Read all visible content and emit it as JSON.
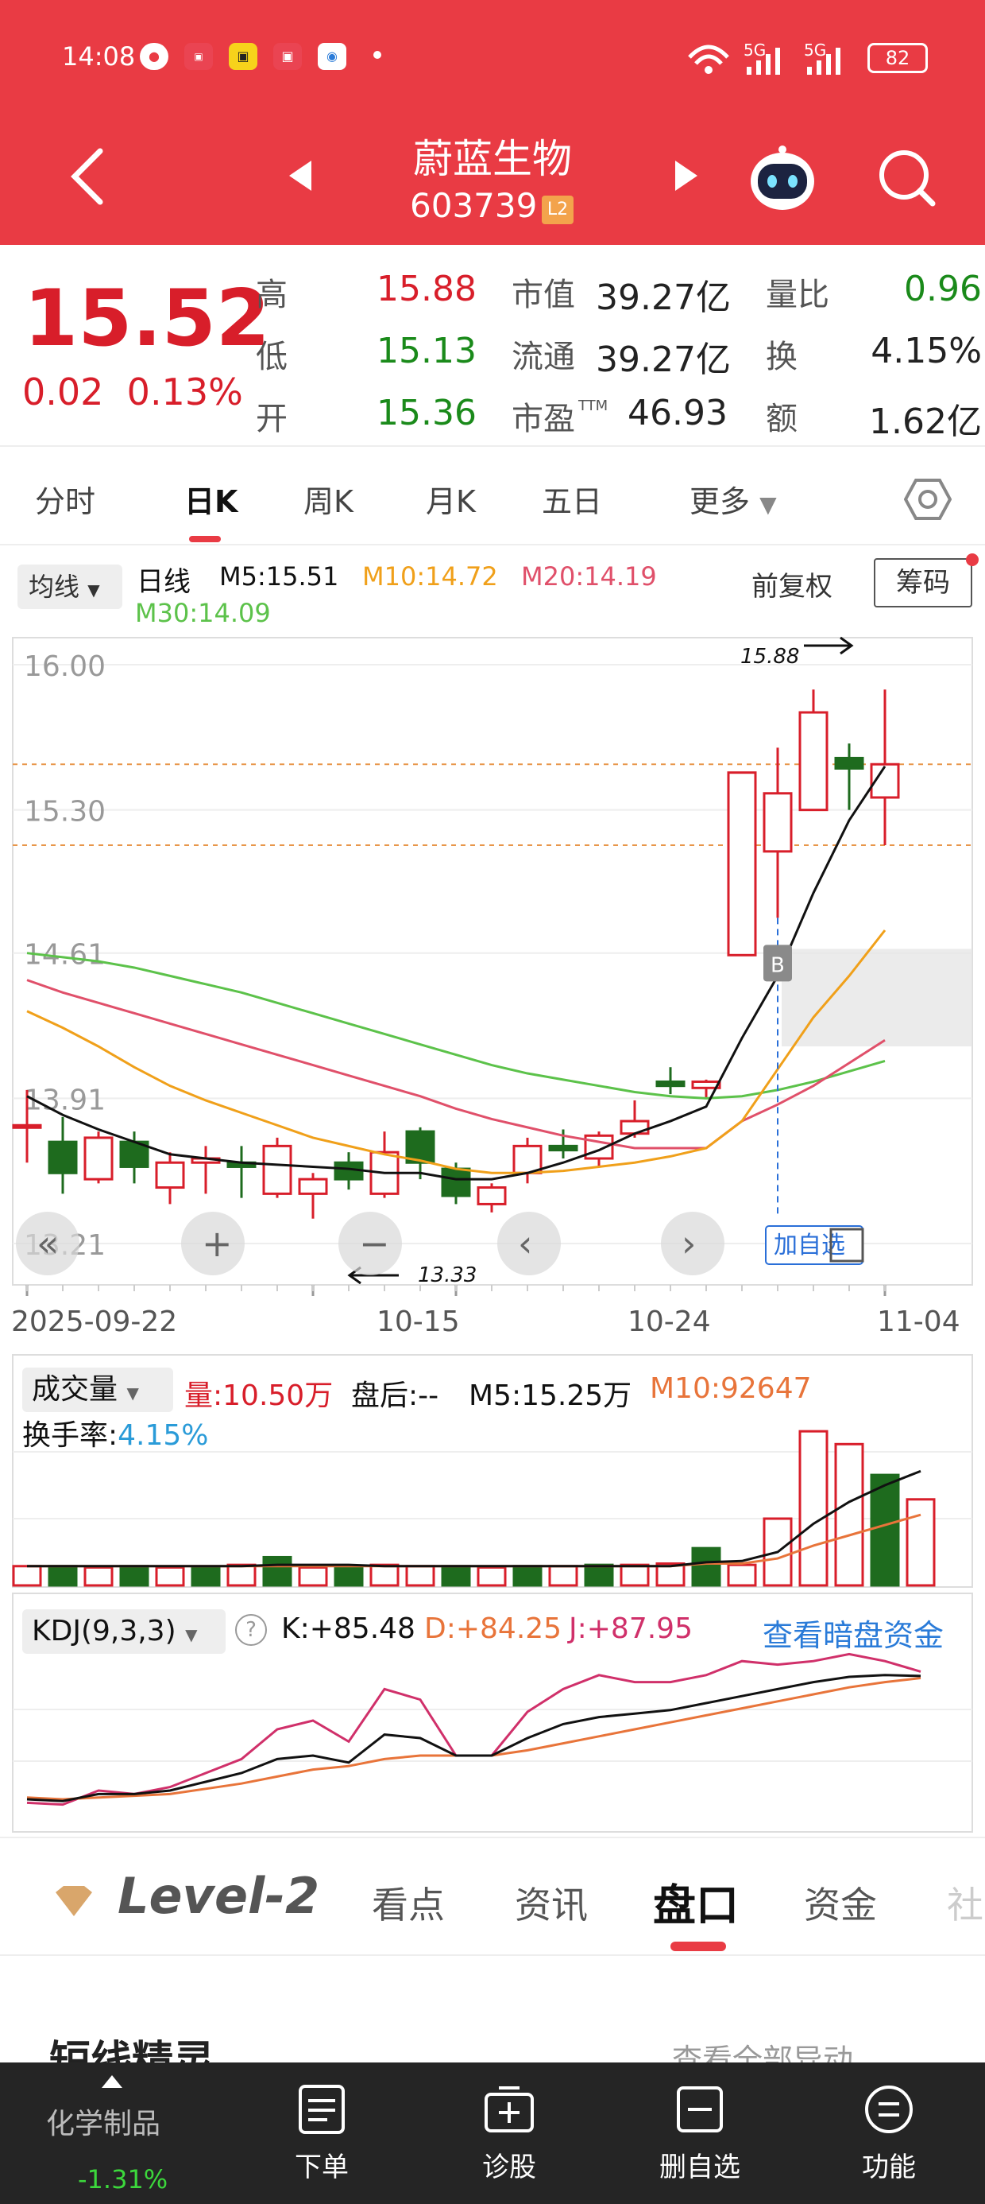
{
  "status": {
    "time": "14:08",
    "battery": "82",
    "signal1": "5G",
    "signal2": "5G"
  },
  "header": {
    "title": "蔚蓝生物",
    "code": "603739",
    "badge": "L2"
  },
  "quote": {
    "price": "15.52",
    "change": "0.02",
    "change_pct": "0.13%",
    "high_label": "高",
    "high": "15.88",
    "low_label": "低",
    "low": "15.13",
    "open_label": "开",
    "open": "15.36",
    "mktcap_label": "市值",
    "mktcap": "39.27亿",
    "float_label": "流通",
    "float": "39.27亿",
    "pe_label": "市盈",
    "pe_sup": "TTM",
    "pe": "46.93",
    "vr_label": "量比",
    "vr": "0.96",
    "turn_label": "换",
    "turn": "4.15%",
    "amt_label": "额",
    "amt": "1.62亿"
  },
  "tabs": [
    "分时",
    "日K",
    "周K",
    "月K",
    "五日",
    "更多"
  ],
  "active_tab": "日K",
  "kline": {
    "ma_selector": "均线",
    "period": "日线",
    "m5": "M5:15.51",
    "m10": "M10:14.72",
    "m20": "M20:14.19",
    "m30": "M30:14.09",
    "adjust": "前复权",
    "chip": "筹码",
    "y_labels": [
      "16.00",
      "15.30",
      "14.61",
      "13.91",
      "13.21"
    ],
    "x_labels": [
      "2025-09-22",
      "10-15",
      "10-24",
      "11-04"
    ],
    "high_annotation": "15.88",
    "low_annotation": "13.33",
    "add_watch": "加自选",
    "marker": "B",
    "colors": {
      "up": "#d81e2a",
      "down": "#1e6b1e",
      "m5": "#111111",
      "m10": "#f0a01a",
      "m20": "#e0506a",
      "m30": "#5cc24a"
    }
  },
  "chart_data": {
    "type": "candlestick",
    "ylim": [
      13.21,
      16.0
    ],
    "candles": [
      {
        "o": 13.78,
        "c": 13.78,
        "h": 13.95,
        "l": 13.6
      },
      {
        "o": 13.7,
        "c": 13.55,
        "h": 13.82,
        "l": 13.45
      },
      {
        "o": 13.52,
        "c": 13.72,
        "h": 13.75,
        "l": 13.5
      },
      {
        "o": 13.7,
        "c": 13.58,
        "h": 13.75,
        "l": 13.5
      },
      {
        "o": 13.48,
        "c": 13.6,
        "h": 13.65,
        "l": 13.4
      },
      {
        "o": 13.6,
        "c": 13.62,
        "h": 13.68,
        "l": 13.45
      },
      {
        "o": 13.6,
        "c": 13.58,
        "h": 13.68,
        "l": 13.43
      },
      {
        "o": 13.45,
        "c": 13.68,
        "h": 13.72,
        "l": 13.43
      },
      {
        "o": 13.45,
        "c": 13.52,
        "h": 13.55,
        "l": 13.33
      },
      {
        "o": 13.6,
        "c": 13.52,
        "h": 13.65,
        "l": 13.47
      },
      {
        "o": 13.45,
        "c": 13.65,
        "h": 13.75,
        "l": 13.43
      },
      {
        "o": 13.75,
        "c": 13.6,
        "h": 13.77,
        "l": 13.52
      },
      {
        "o": 13.57,
        "c": 13.44,
        "h": 13.6,
        "l": 13.4
      },
      {
        "o": 13.4,
        "c": 13.48,
        "h": 13.5,
        "l": 13.36
      },
      {
        "o": 13.55,
        "c": 13.68,
        "h": 13.72,
        "l": 13.5
      },
      {
        "o": 13.68,
        "c": 13.66,
        "h": 13.76,
        "l": 13.62
      },
      {
        "o": 13.62,
        "c": 13.73,
        "h": 13.75,
        "l": 13.58
      },
      {
        "o": 13.74,
        "c": 13.8,
        "h": 13.9,
        "l": 13.72
      },
      {
        "o": 13.99,
        "c": 13.97,
        "h": 14.06,
        "l": 13.93
      },
      {
        "o": 13.96,
        "c": 13.99,
        "h": 14.0,
        "l": 13.91
      },
      {
        "o": 14.6,
        "c": 15.48,
        "h": 15.48,
        "l": 14.6
      },
      {
        "o": 15.1,
        "c": 15.38,
        "h": 15.6,
        "l": 14.78
      },
      {
        "o": 15.3,
        "c": 15.77,
        "h": 15.88,
        "l": 15.3
      },
      {
        "o": 15.55,
        "c": 15.5,
        "h": 15.62,
        "l": 15.3
      },
      {
        "o": 15.36,
        "c": 15.52,
        "h": 15.88,
        "l": 15.13
      }
    ],
    "m5": [
      13.92,
      13.83,
      13.76,
      13.7,
      13.64,
      13.62,
      13.6,
      13.59,
      13.58,
      13.57,
      13.55,
      13.55,
      13.52,
      13.52,
      13.55,
      13.6,
      13.66,
      13.74,
      13.8,
      13.87,
      14.2,
      14.5,
      14.9,
      15.25,
      15.51
    ],
    "m10": [
      14.33,
      14.25,
      14.16,
      14.06,
      13.97,
      13.9,
      13.84,
      13.78,
      13.72,
      13.68,
      13.64,
      13.61,
      13.57,
      13.55,
      13.55,
      13.56,
      13.58,
      13.6,
      13.63,
      13.67,
      13.8,
      14.05,
      14.3,
      14.5,
      14.72
    ],
    "m20": [
      14.48,
      14.42,
      14.37,
      14.32,
      14.27,
      14.22,
      14.17,
      14.12,
      14.07,
      14.02,
      13.97,
      13.92,
      13.86,
      13.81,
      13.77,
      13.73,
      13.7,
      13.67,
      13.67,
      13.67,
      13.8,
      13.88,
      13.97,
      14.08,
      14.19
    ],
    "m30": [
      14.61,
      14.59,
      14.57,
      14.54,
      14.5,
      14.46,
      14.42,
      14.37,
      14.32,
      14.27,
      14.22,
      14.17,
      14.12,
      14.07,
      14.03,
      14.0,
      13.97,
      13.94,
      13.92,
      13.91,
      13.92,
      13.95,
      13.99,
      14.04,
      14.09
    ]
  },
  "volume": {
    "selector": "成交量",
    "vol": "量:10.50万",
    "after": "盘后:--",
    "m5": "M5:15.25万",
    "m10": "M10:92647",
    "turnover_label": "换手率:",
    "turnover": "4.15%",
    "values": [
      0.15,
      0.15,
      0.14,
      0.15,
      0.14,
      0.14,
      0.16,
      0.22,
      0.14,
      0.14,
      0.16,
      0.15,
      0.15,
      0.14,
      0.15,
      0.15,
      0.16,
      0.16,
      0.17,
      0.29,
      0.16,
      0.52,
      1.2,
      1.1,
      0.86,
      0.67
    ],
    "ma5": [
      0.15,
      0.15,
      0.15,
      0.15,
      0.15,
      0.15,
      0.15,
      0.16,
      0.16,
      0.16,
      0.15,
      0.15,
      0.15,
      0.15,
      0.15,
      0.15,
      0.15,
      0.15,
      0.15,
      0.18,
      0.19,
      0.26,
      0.48,
      0.65,
      0.78,
      0.89
    ],
    "ma10": [
      0.15,
      0.15,
      0.15,
      0.15,
      0.15,
      0.15,
      0.15,
      0.15,
      0.15,
      0.15,
      0.15,
      0.15,
      0.15,
      0.15,
      0.15,
      0.15,
      0.15,
      0.15,
      0.15,
      0.17,
      0.17,
      0.21,
      0.31,
      0.39,
      0.47,
      0.55
    ]
  },
  "kdj": {
    "selector": "KDJ(9,3,3)",
    "k": "K:+85.48",
    "d": "D:+84.25",
    "j": "J:+87.95",
    "link": "查看暗盘资金",
    "K": [
      15,
      14,
      18,
      18,
      20,
      25,
      30,
      38,
      40,
      36,
      52,
      50,
      40,
      40,
      50,
      58,
      62,
      64,
      66,
      70,
      74,
      78,
      82,
      85,
      86,
      85.5
    ],
    "D": [
      16,
      15,
      16,
      17,
      18,
      21,
      24,
      28,
      32,
      34,
      38,
      40,
      40,
      40,
      43,
      47,
      51,
      55,
      59,
      63,
      67,
      71,
      75,
      79,
      82,
      84.3
    ],
    "J": [
      13,
      12,
      20,
      18,
      22,
      30,
      38,
      55,
      60,
      48,
      78,
      72,
      40,
      40,
      65,
      78,
      86,
      82,
      82,
      86,
      94,
      92,
      94,
      98,
      94,
      88
    ]
  },
  "level2_tabs": [
    "看点",
    "资讯",
    "盘口",
    "资金",
    "社"
  ],
  "level2_label": "Level-2",
  "section": {
    "title": "短线精灵",
    "link": "查看全部异动"
  },
  "bottom": {
    "sector": "化学制品",
    "sector_chg": "-1.31%",
    "order": "下单",
    "diagnose": "诊股",
    "remove": "删自选",
    "func": "功能"
  }
}
